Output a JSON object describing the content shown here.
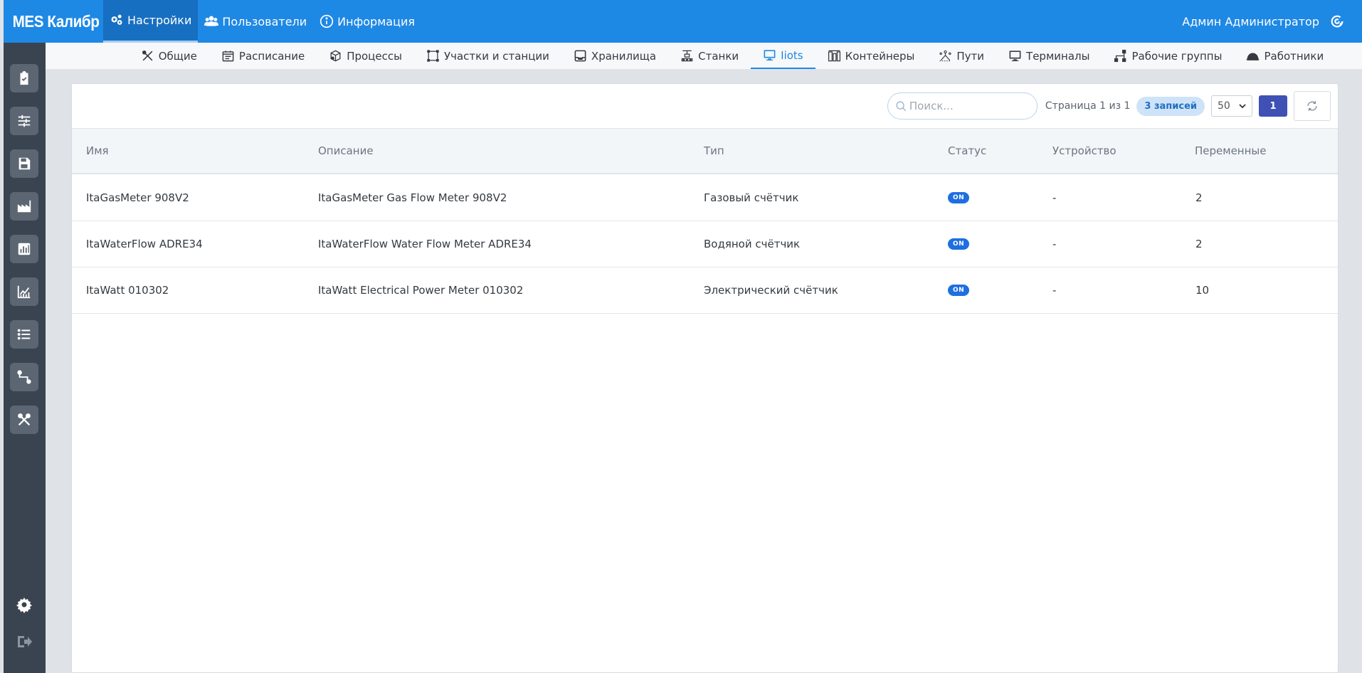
{
  "app": {
    "brand": "MES Калибр",
    "user_name": "Админ Администратор"
  },
  "topnav": {
    "items": [
      {
        "label": "Настройки",
        "icon": "gears-icon",
        "active": true
      },
      {
        "label": "Пользователи",
        "icon": "users-icon",
        "active": false
      },
      {
        "label": "Информация",
        "icon": "info-icon",
        "active": false
      }
    ]
  },
  "sidebar": {
    "items": [
      {
        "icon": "clipboard-check-icon"
      },
      {
        "icon": "sliders-icon"
      },
      {
        "icon": "save-icon"
      },
      {
        "icon": "factory-icon"
      },
      {
        "icon": "bar-chart-icon"
      },
      {
        "icon": "line-chart-icon"
      },
      {
        "icon": "list-icon"
      },
      {
        "icon": "route-icon"
      },
      {
        "icon": "tools-icon"
      }
    ],
    "bottom": [
      {
        "icon": "gear-icon"
      },
      {
        "icon": "logout-icon"
      }
    ]
  },
  "subnav": {
    "tabs": [
      {
        "label": "Общие",
        "icon": "tools-icon"
      },
      {
        "label": "Расписание",
        "icon": "calendar-icon"
      },
      {
        "label": "Процессы",
        "icon": "cube-icon"
      },
      {
        "label": "Участки и станции",
        "icon": "area-icon"
      },
      {
        "label": "Хранилища",
        "icon": "inbox-icon"
      },
      {
        "label": "Станки",
        "icon": "machine-icon"
      },
      {
        "label": "Iiots",
        "icon": "monitor-icon"
      },
      {
        "label": "Контейнеры",
        "icon": "containers-icon"
      },
      {
        "label": "Пути",
        "icon": "path-icon"
      },
      {
        "label": "Терминалы",
        "icon": "terminal-icon"
      },
      {
        "label": "Рабочие группы",
        "icon": "group-icon"
      },
      {
        "label": "Работники",
        "icon": "helmet-icon"
      }
    ],
    "active_index": 6
  },
  "toolbar": {
    "search_placeholder": "Поиск...",
    "page_info": "Страница 1 из 1",
    "records_badge": "3 записей",
    "per_page": "50",
    "current_page": "1"
  },
  "table": {
    "columns": [
      "Имя",
      "Описание",
      "Тип",
      "Статус",
      "Устройство",
      "Переменные"
    ],
    "rows": [
      {
        "name": "ItaGasMeter 908V2",
        "description": "ItaGasMeter Gas Flow Meter 908V2",
        "type": "Газовый счётчик",
        "status": "ON",
        "device": "-",
        "variables": "2"
      },
      {
        "name": "ItaWaterFlow ADRE34",
        "description": "ItaWaterFlow Water Flow Meter ADRE34",
        "type": "Водяной счётчик",
        "status": "ON",
        "device": "-",
        "variables": "2"
      },
      {
        "name": "ItaWatt 010302",
        "description": "ItaWatt Electrical Power Meter 010302",
        "type": "Электрический счётчик",
        "status": "ON",
        "device": "-",
        "variables": "10"
      }
    ]
  },
  "colors": {
    "topbar": "#1e88e5",
    "sidebar": "#3a4450",
    "accent": "#1e88e5",
    "status_on": "#1e6fe0",
    "page_button": "#3f51b5"
  }
}
